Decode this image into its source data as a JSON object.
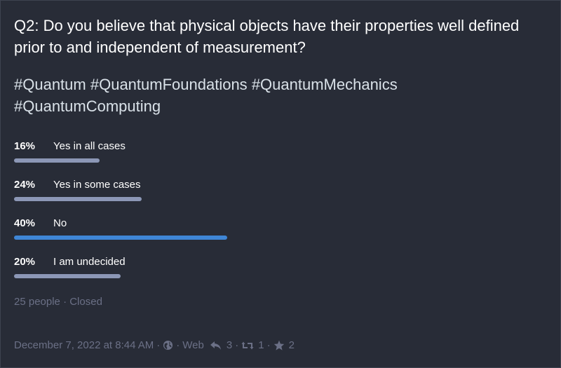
{
  "status": {
    "question": "Q2: Do you believe that physical objects have their properties well defined prior to and independent of measurement?",
    "hashtags": [
      "#Quantum",
      "#QuantumFoundations",
      "#QuantumMechanics",
      "#QuantumComputing"
    ]
  },
  "poll": {
    "options": [
      {
        "percent_label": "16%",
        "label": "Yes in all cases",
        "percent": 16,
        "leading": false
      },
      {
        "percent_label": "24%",
        "label": "Yes in some cases",
        "percent": 24,
        "leading": false
      },
      {
        "percent_label": "40%",
        "label": "No",
        "percent": 40,
        "leading": true
      },
      {
        "percent_label": "20%",
        "label": "I am undecided",
        "percent": 20,
        "leading": false
      }
    ],
    "footer": "25 people · Closed"
  },
  "meta": {
    "date": "December 7, 2022 at 8:44 AM",
    "visibility_icon": "globe-icon",
    "application": "Web",
    "replies_count": "3",
    "boosts_count": "1",
    "favourites_count": "2"
  },
  "colors": {
    "background": "#282c37",
    "bar": "#8c97b6",
    "bar_leading": "#3f86d6",
    "muted_text": "#6b7086"
  }
}
